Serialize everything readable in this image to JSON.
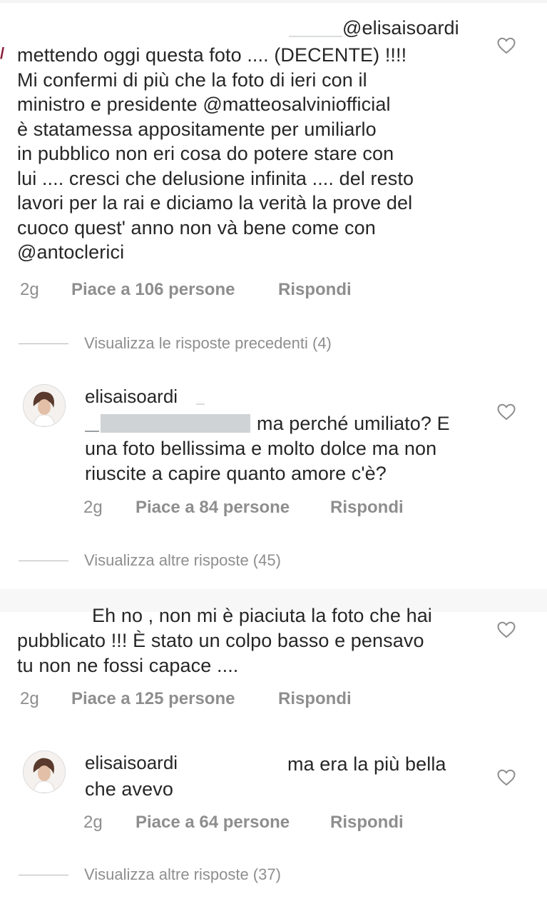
{
  "comment1": {
    "mention": "@elisaisoardi",
    "lines": [
      "mettendo oggi questa foto .... (DECENTE) !!!!",
      "Mi confermi di più  che la foto di ieri con il",
      "ministro e presidente @matteosalviniofficial",
      "è statamessa appositamente per umiliarlo",
      "in pubblico non eri cosa do potere stare con",
      "lui .... cresci che delusione infinita .... del resto",
      "lavori per la rai e diciamo la verità la prove del",
      "cuoco quest' anno non và bene come con",
      "@antoclerici"
    ],
    "time": "2g",
    "likes": "Piace a 106 persone",
    "reply": "Rispondi"
  },
  "view_previous": "Visualizza le risposte precedenti (4)",
  "reply1": {
    "username": "elisaisoardi",
    "lines": [
      "ma perché umiliato? E",
      "una foto bellissima e molto dolce ma non",
      "riuscite a capire quanto amore c'è?"
    ],
    "time": "2g",
    "likes": "Piace a 84 persone",
    "reply": "Rispondi"
  },
  "view_more_1": "Visualizza altre risposte (45)",
  "comment2": {
    "lines": [
      "Eh no , non mi è piaciuta la foto che hai",
      "pubblicato !!! È stato un colpo basso e pensavo",
      "tu non ne fossi capace ...."
    ],
    "time": "2g",
    "likes": "Piace a 125 persone",
    "reply": "Rispondi"
  },
  "reply2": {
    "username": "elisaisoardi",
    "lines": [
      "ma era la più bella",
      "che avevo"
    ],
    "time": "2g",
    "likes": "Piace a 64 persone",
    "reply": "Rispondi"
  },
  "view_more_2": "Visualizza altre risposte (37)",
  "icons": {
    "like": "heart-outline-icon",
    "avatar": "profile-avatar-icon"
  },
  "colors": {
    "text": "#262626",
    "secondary": "#8e8e8e",
    "divider": "#b5b5b5",
    "redaction": "#cfd3d6"
  }
}
